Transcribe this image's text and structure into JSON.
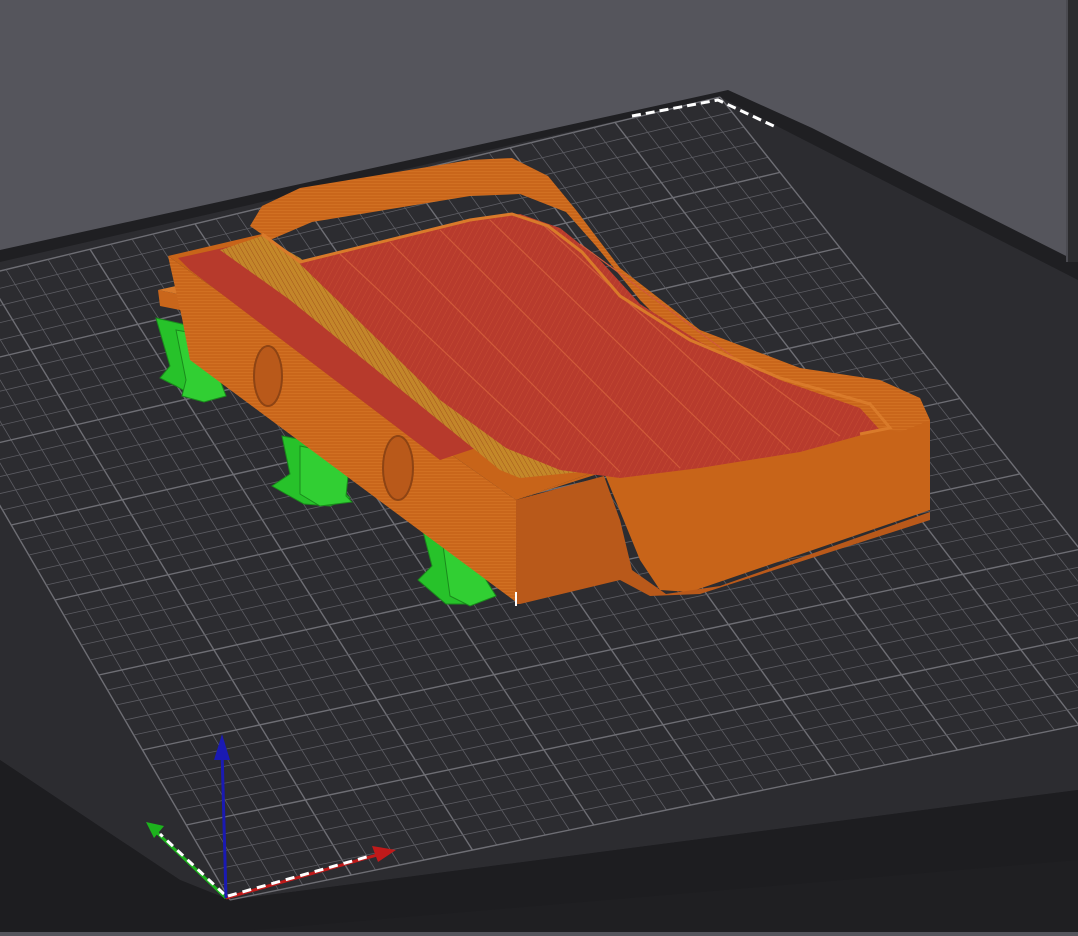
{
  "app": {
    "view": "3d-preview",
    "theme": "dark"
  },
  "colors": {
    "background": "#55555c",
    "bed": "#2c2c30",
    "bed_edge": "#1c1c1f",
    "grid_line": "#5c5c62",
    "grid_major": "#6e6e74",
    "model_wall": "#c9661b",
    "model_top": "#b73a2c",
    "supports": "#27c22a",
    "axis_x": "#c01a1a",
    "axis_y": "#1db31d",
    "axis_z": "#1a1ab3"
  },
  "scene": {
    "objects": [
      {
        "name": "printed-part",
        "type": "model",
        "features": [
          "outer-wall",
          "top-surface",
          "inner-tray",
          "side-holes"
        ]
      },
      {
        "name": "support-structures",
        "type": "supports",
        "count": 6
      }
    ],
    "axes": [
      "x",
      "y",
      "z"
    ]
  }
}
